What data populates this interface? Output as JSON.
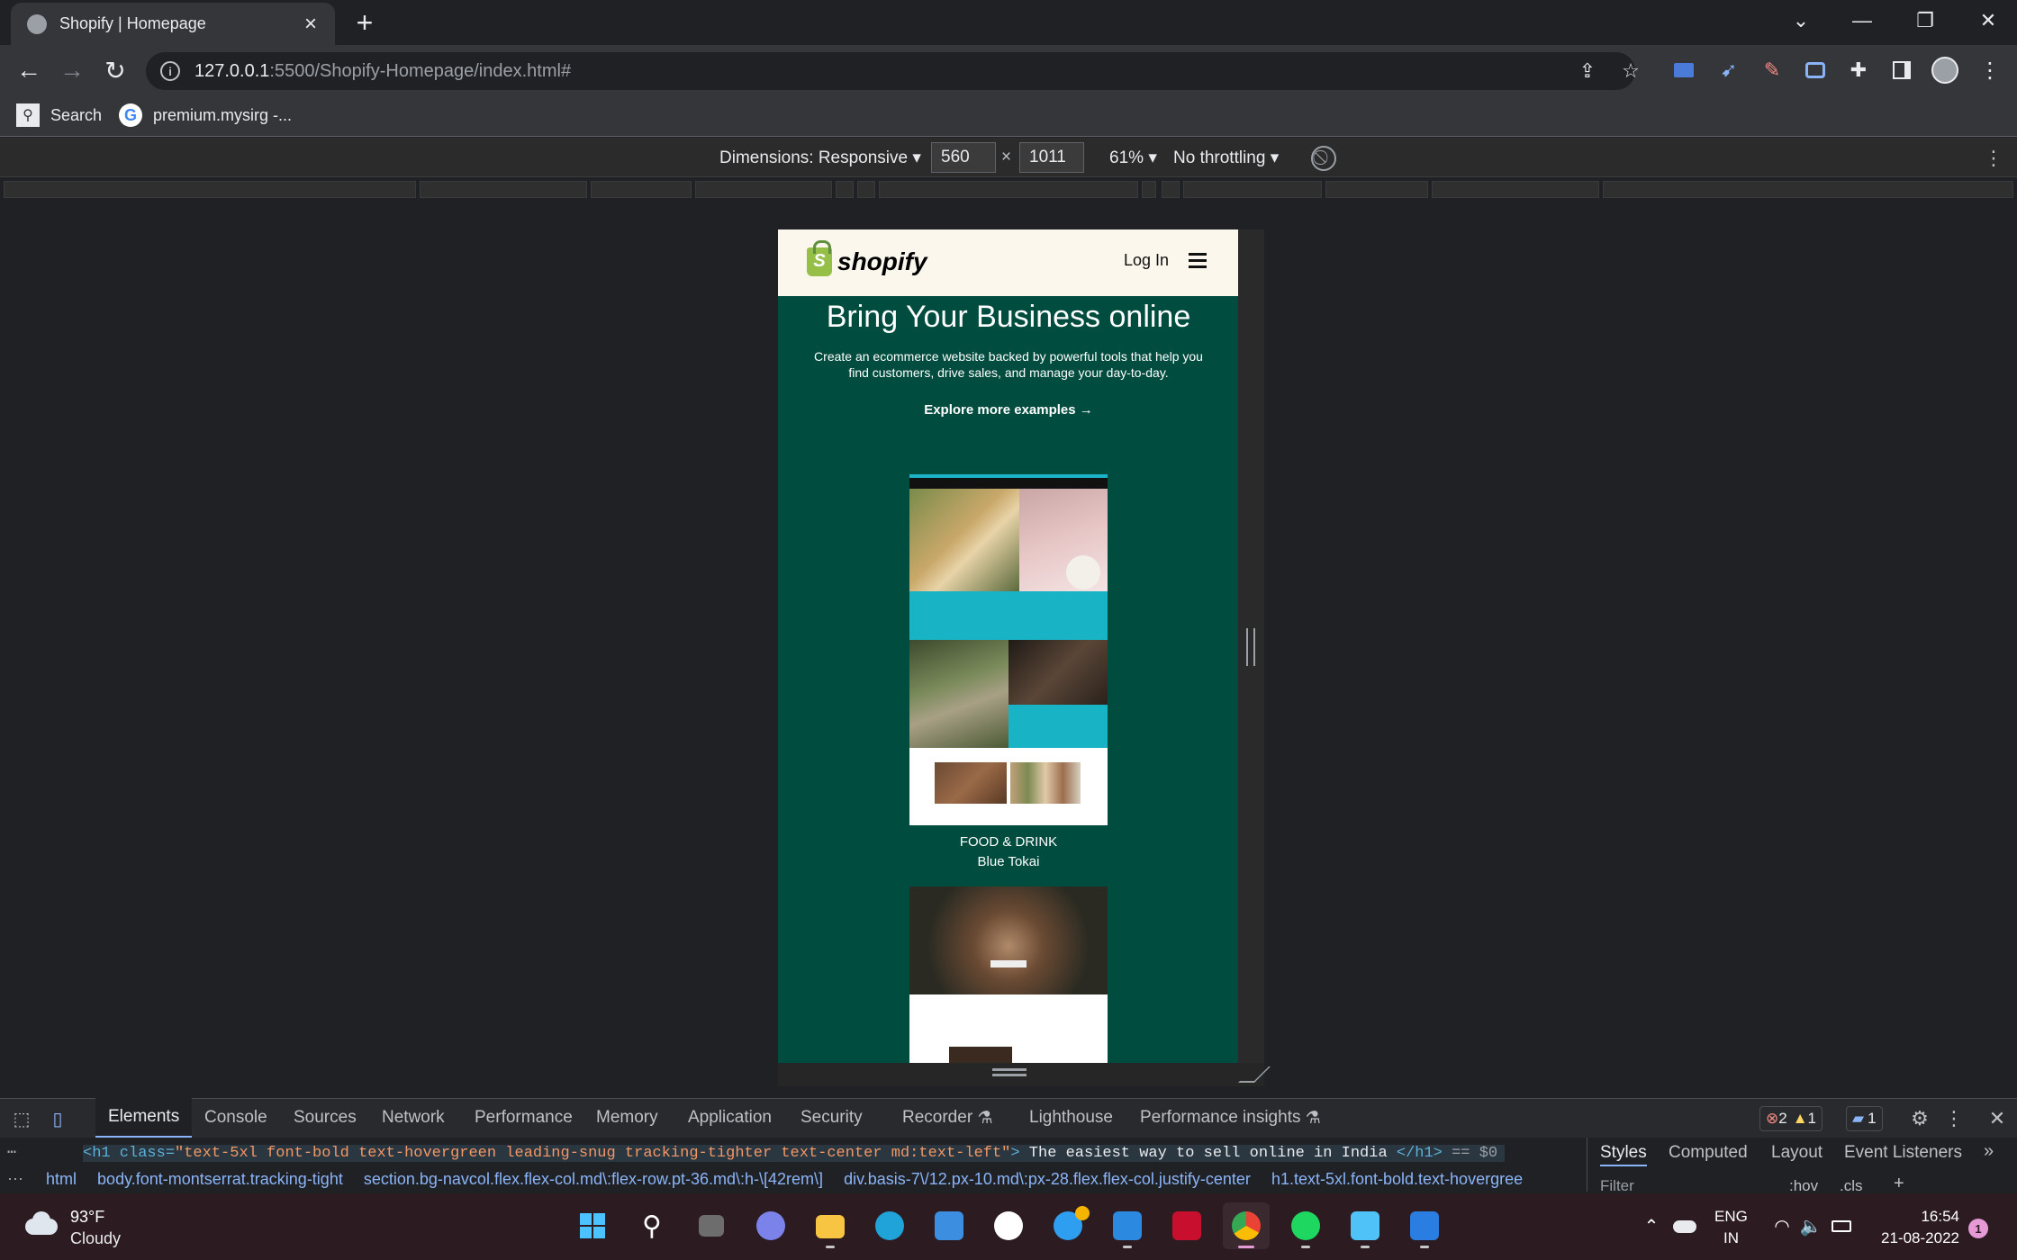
{
  "browser": {
    "tab_title": "Shopify | Homepage",
    "url_host": "127.0.0.1",
    "url_path": ":5500/Shopify-Homepage/index.html#",
    "bookmarks": [
      {
        "label": "Search",
        "icon": "search-icon"
      },
      {
        "label": "premium.mysirg -...",
        "icon": "google-icon"
      }
    ]
  },
  "device_toolbar": {
    "dimensions_label": "Dimensions: Responsive",
    "width": "560",
    "height": "1011",
    "times": "×",
    "zoom": "61%",
    "throttling": "No throttling"
  },
  "site": {
    "brand": "shopify",
    "login_label": "Log In",
    "hero_title": "Bring Your Business online",
    "hero_text": "Create an ecommerce website backed by powerful tools that help you find customers, drive sales, and manage your day-to-day.",
    "explore_label": "Explore more examples →",
    "examples": [
      {
        "category": "FOOD & DRINK",
        "name": "Blue Tokai"
      }
    ]
  },
  "devtools": {
    "tabs": [
      "Elements",
      "Console",
      "Sources",
      "Network",
      "Performance",
      "Memory",
      "Application",
      "Security",
      "Recorder",
      "Lighthouse",
      "Performance insights"
    ],
    "active_tab": "Elements",
    "errors": "2",
    "warnings": "1",
    "messages": "1",
    "code_line": {
      "open": "<h1 class=",
      "class_val": "\"text-5xl font-bold text-hovergreen leading-snug tracking-tighter text-center md:text-left\"",
      "close": ">",
      "text": " The easiest way to sell online in India ",
      "end": "</h1>",
      "eq": " == $0"
    },
    "breadcrumbs": [
      "html",
      "body.font-montserrat.tracking-tight",
      "section.bg-navcol.flex.flex-col.md\\:flex-row.pt-36.md\\:h-\\[42rem\\]",
      "div.basis-7\\/12.px-10.md\\:px-28.flex.flex-col.justify-center",
      "h1.text-5xl.font-bold.text-hovergree"
    ],
    "side_tabs": [
      "Styles",
      "Computed",
      "Layout",
      "Event Listeners"
    ],
    "filter_placeholder": "Filter",
    "hov": ":hov",
    "cls": ".cls"
  },
  "taskbar": {
    "weather_temp": "93°F",
    "weather_desc": "Cloudy",
    "lang": "ENG",
    "region": "IN",
    "time": "16:54",
    "date": "21-08-2022",
    "notifications": "1"
  },
  "colors": {
    "site_green": "#004c3f",
    "nav_cream": "#fbf7ed",
    "shopify_green": "#95bf47"
  }
}
